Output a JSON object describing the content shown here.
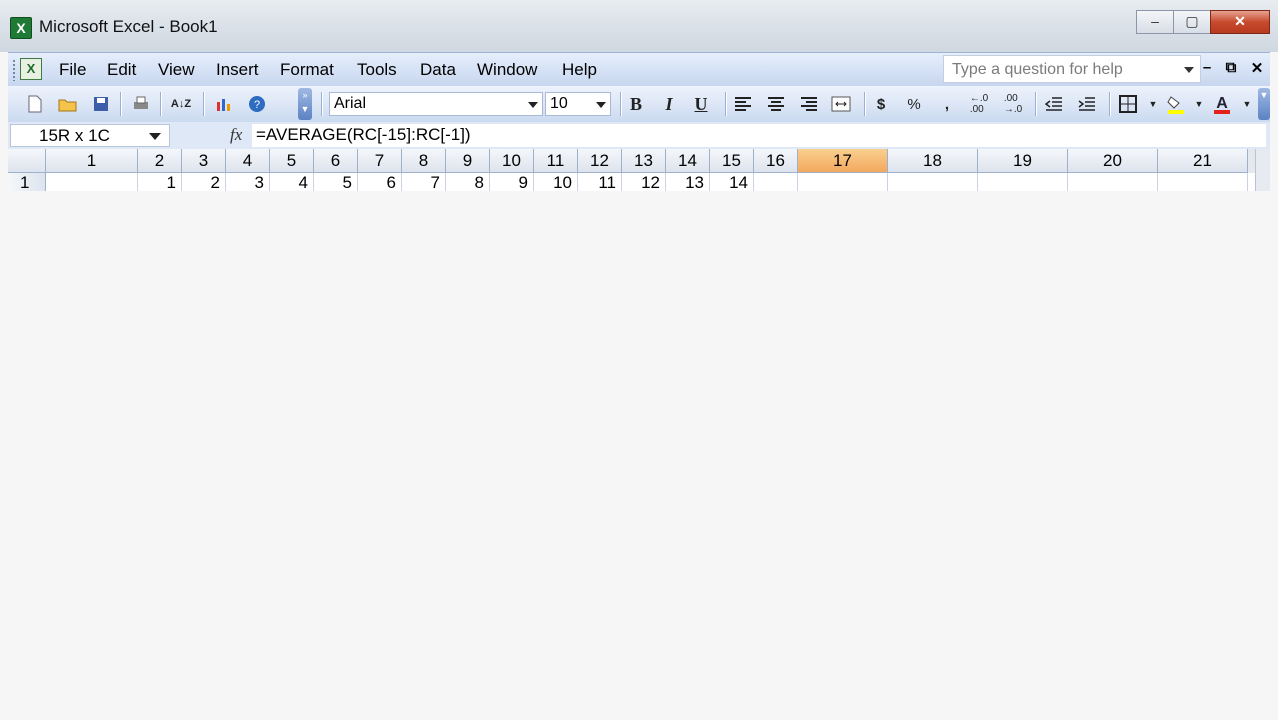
{
  "window": {
    "title": "Microsoft Excel - Book1",
    "app_icon_letter": "X",
    "buttons": [
      "minimize",
      "maximize",
      "close"
    ]
  },
  "menubar": {
    "items": [
      "File",
      "Edit",
      "View",
      "Insert",
      "Format",
      "Tools",
      "Data",
      "Window",
      "Help"
    ],
    "help_placeholder": "Type a question for help"
  },
  "toolbar": {
    "font_name": "Arial",
    "font_size": "10",
    "bold": "B",
    "italic": "I",
    "underline": "U",
    "currency": "$",
    "percent": "%",
    "comma": ","
  },
  "formula_bar": {
    "name_box": "15R x 1C",
    "fx": "fx",
    "formula": "=AVERAGE(RC[-15]:RC[-1])"
  },
  "sheet": {
    "column_headers": [
      "1",
      "2",
      "3",
      "4",
      "5",
      "6",
      "7",
      "8",
      "9",
      "10",
      "11",
      "12",
      "13",
      "14",
      "15",
      "16",
      "17",
      "18",
      "19",
      "20",
      "21"
    ],
    "active_column": "17",
    "row_header": "1",
    "row1_values": [
      "",
      "1",
      "2",
      "3",
      "4",
      "5",
      "6",
      "7",
      "8",
      "9",
      "10",
      "11",
      "12",
      "13",
      "14",
      "",
      "",
      "",
      "",
      "",
      ""
    ]
  },
  "colors": {
    "active_header": "#f3a85e",
    "menubar": "#c6d6ef",
    "close_button": "#c64b2e"
  }
}
